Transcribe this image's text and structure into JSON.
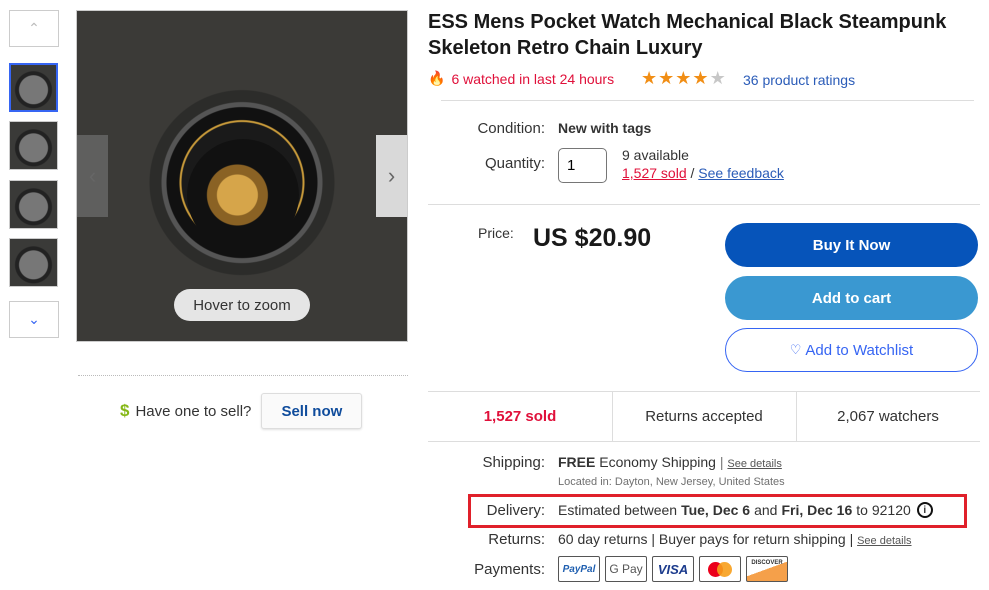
{
  "gallery": {
    "hover_label": "Hover to zoom",
    "thumbnail_count": 4,
    "selected_index": 0
  },
  "sell": {
    "prompt": "Have one to sell?",
    "button_label": "Sell now"
  },
  "product": {
    "title": "ESS Mens Pocket Watch Mechanical Black Steampunk Skeleton Retro Chain Luxury",
    "watched": "6 watched in last 24 hours",
    "rating": 4,
    "rating_max": 5,
    "ratings_link": "36 product ratings"
  },
  "details": {
    "condition_label": "Condition:",
    "condition_value": "New with tags",
    "quantity_label": "Quantity:",
    "quantity_value": "1",
    "available": "9 available",
    "sold_link": "1,527 sold",
    "separator": "/",
    "feedback_link": "See feedback"
  },
  "price": {
    "label": "Price:",
    "value": "US $20.90"
  },
  "actions": {
    "buy_now": "Buy It Now",
    "add_to_cart": "Add to cart",
    "watchlist": "Add to Watchlist"
  },
  "stats": {
    "sold": "1,527 sold",
    "returns": "Returns accepted",
    "watchers": "2,067 watchers"
  },
  "shipping": {
    "label": "Shipping:",
    "free": "FREE",
    "method": "Economy Shipping",
    "details_link": "See details",
    "location": "Located in: Dayton, New Jersey, United States"
  },
  "delivery": {
    "label": "Delivery:",
    "prefix": "Estimated between",
    "start": "Tue, Dec 6",
    "and": "and",
    "end": "Fri, Dec 16",
    "to": "to 92120"
  },
  "returns": {
    "label": "Returns:",
    "text": "60 day returns | Buyer pays for return shipping |",
    "details_link": "See details"
  },
  "payments": {
    "label": "Payments:",
    "methods": [
      "PayPal",
      "G Pay",
      "VISA",
      "Mastercard",
      "DISCOVER"
    ]
  },
  "colors": {
    "primary": "#0654ba",
    "secondary": "#3a98d1",
    "accent_red": "#e0103a",
    "highlight_box": "#e0202a"
  }
}
